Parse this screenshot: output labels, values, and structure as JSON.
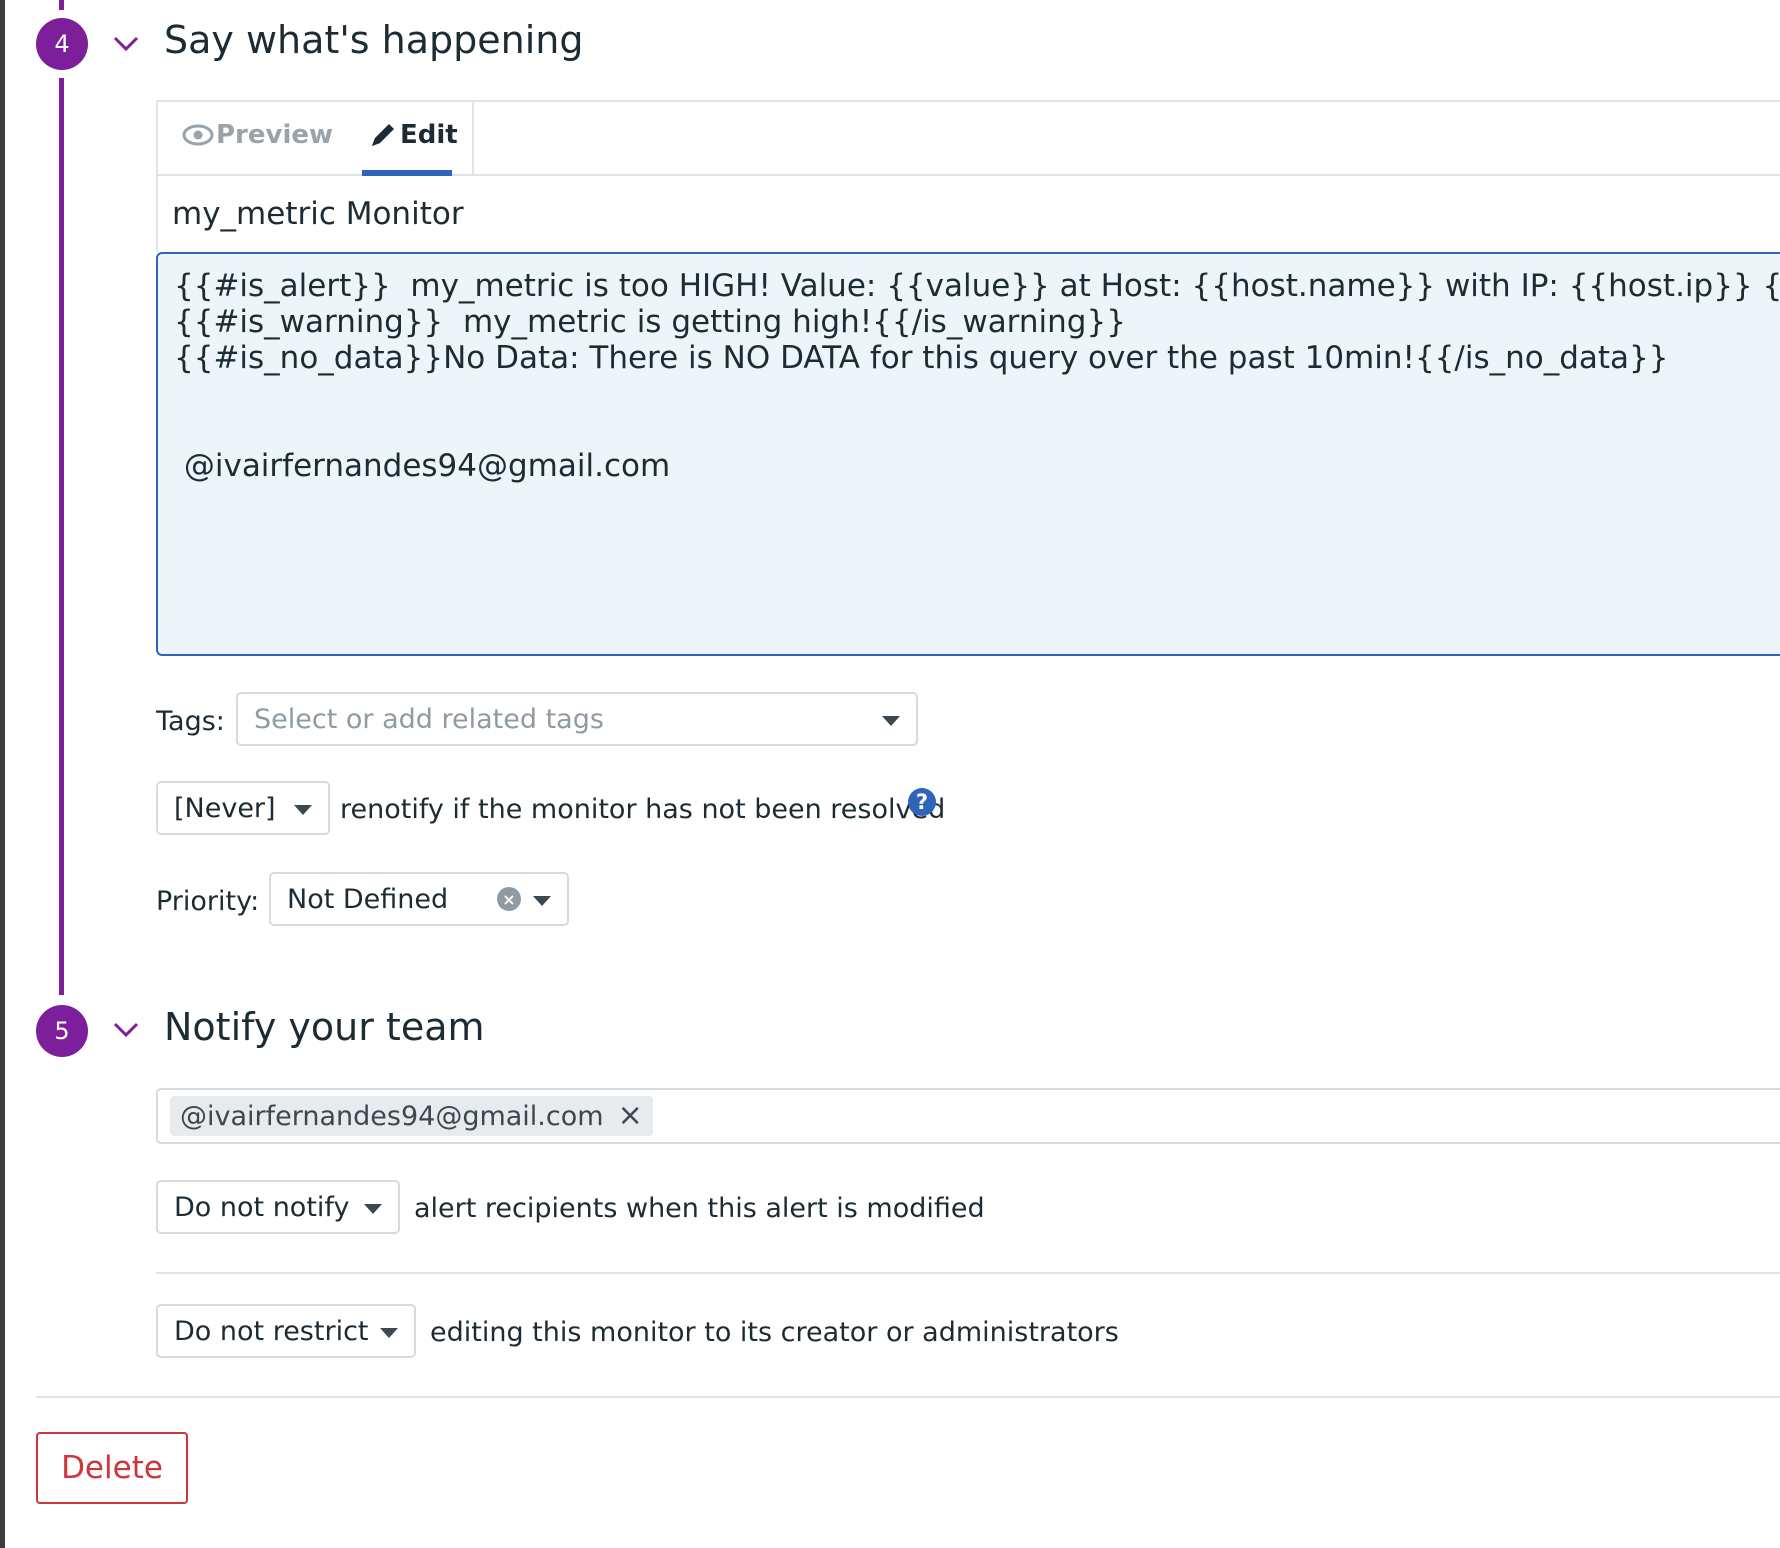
{
  "step4": {
    "number": "4",
    "title": "Say what's happening",
    "tabs": {
      "preview_label": "Preview",
      "edit_label": "Edit",
      "active": "Edit"
    },
    "monitor_title": "my_metric Monitor",
    "message": "{{#is_alert}}  my_metric is too HIGH! Value: {{value}} at Host: {{host.name}} with IP: {{host.ip}} {{/is_alert}}\n{{#is_warning}}  my_metric is getting high!{{/is_warning}}\n{{#is_no_data}}No Data: There is NO DATA for this query over the past 10min!{{/is_no_data}}\n\n\n @ivairfernandes94@gmail.com",
    "tags_label": "Tags:",
    "tags_placeholder": "Select or add related tags",
    "renotify_value": "[Never]",
    "renotify_text": "renotify if the monitor has not been resolved",
    "help_glyph": "?",
    "priority_label": "Priority:",
    "priority_value": "Not Defined"
  },
  "step5": {
    "number": "5",
    "title": "Notify your team",
    "recipients": [
      "@ivairfernandes94@gmail.com"
    ],
    "notify_value": "Do not notify",
    "notify_text": "alert recipients when this alert is modified",
    "restrict_value": "Do not restrict",
    "restrict_text": "editing this monitor to its creator or administrators"
  },
  "actions": {
    "delete_label": "Delete"
  },
  "colors": {
    "step_purple": "#7d1f9b",
    "accent_blue": "#2f64b9",
    "danger_red": "#d0353b",
    "editor_bg": "#edf5fb"
  },
  "icons": [
    "eye-icon",
    "pencil-icon",
    "chevron-down-icon",
    "caret-down-icon",
    "help-icon",
    "clear-icon",
    "close-icon"
  ]
}
